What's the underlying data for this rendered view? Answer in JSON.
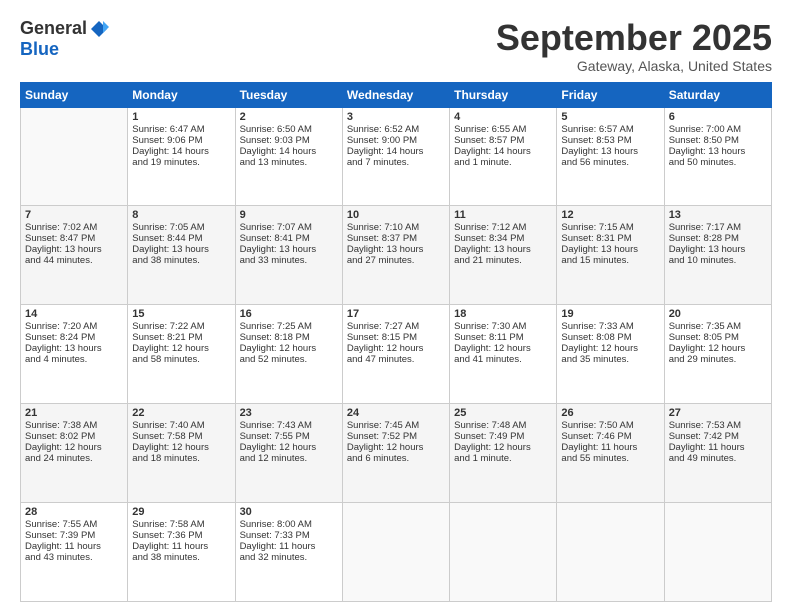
{
  "header": {
    "logo_general": "General",
    "logo_blue": "Blue",
    "month": "September 2025",
    "location": "Gateway, Alaska, United States"
  },
  "weekdays": [
    "Sunday",
    "Monday",
    "Tuesday",
    "Wednesday",
    "Thursday",
    "Friday",
    "Saturday"
  ],
  "weeks": [
    [
      {
        "day": "",
        "info": ""
      },
      {
        "day": "1",
        "info": "Sunrise: 6:47 AM\nSunset: 9:06 PM\nDaylight: 14 hours\nand 19 minutes."
      },
      {
        "day": "2",
        "info": "Sunrise: 6:50 AM\nSunset: 9:03 PM\nDaylight: 14 hours\nand 13 minutes."
      },
      {
        "day": "3",
        "info": "Sunrise: 6:52 AM\nSunset: 9:00 PM\nDaylight: 14 hours\nand 7 minutes."
      },
      {
        "day": "4",
        "info": "Sunrise: 6:55 AM\nSunset: 8:57 PM\nDaylight: 14 hours\nand 1 minute."
      },
      {
        "day": "5",
        "info": "Sunrise: 6:57 AM\nSunset: 8:53 PM\nDaylight: 13 hours\nand 56 minutes."
      },
      {
        "day": "6",
        "info": "Sunrise: 7:00 AM\nSunset: 8:50 PM\nDaylight: 13 hours\nand 50 minutes."
      }
    ],
    [
      {
        "day": "7",
        "info": "Sunrise: 7:02 AM\nSunset: 8:47 PM\nDaylight: 13 hours\nand 44 minutes."
      },
      {
        "day": "8",
        "info": "Sunrise: 7:05 AM\nSunset: 8:44 PM\nDaylight: 13 hours\nand 38 minutes."
      },
      {
        "day": "9",
        "info": "Sunrise: 7:07 AM\nSunset: 8:41 PM\nDaylight: 13 hours\nand 33 minutes."
      },
      {
        "day": "10",
        "info": "Sunrise: 7:10 AM\nSunset: 8:37 PM\nDaylight: 13 hours\nand 27 minutes."
      },
      {
        "day": "11",
        "info": "Sunrise: 7:12 AM\nSunset: 8:34 PM\nDaylight: 13 hours\nand 21 minutes."
      },
      {
        "day": "12",
        "info": "Sunrise: 7:15 AM\nSunset: 8:31 PM\nDaylight: 13 hours\nand 15 minutes."
      },
      {
        "day": "13",
        "info": "Sunrise: 7:17 AM\nSunset: 8:28 PM\nDaylight: 13 hours\nand 10 minutes."
      }
    ],
    [
      {
        "day": "14",
        "info": "Sunrise: 7:20 AM\nSunset: 8:24 PM\nDaylight: 13 hours\nand 4 minutes."
      },
      {
        "day": "15",
        "info": "Sunrise: 7:22 AM\nSunset: 8:21 PM\nDaylight: 12 hours\nand 58 minutes."
      },
      {
        "day": "16",
        "info": "Sunrise: 7:25 AM\nSunset: 8:18 PM\nDaylight: 12 hours\nand 52 minutes."
      },
      {
        "day": "17",
        "info": "Sunrise: 7:27 AM\nSunset: 8:15 PM\nDaylight: 12 hours\nand 47 minutes."
      },
      {
        "day": "18",
        "info": "Sunrise: 7:30 AM\nSunset: 8:11 PM\nDaylight: 12 hours\nand 41 minutes."
      },
      {
        "day": "19",
        "info": "Sunrise: 7:33 AM\nSunset: 8:08 PM\nDaylight: 12 hours\nand 35 minutes."
      },
      {
        "day": "20",
        "info": "Sunrise: 7:35 AM\nSunset: 8:05 PM\nDaylight: 12 hours\nand 29 minutes."
      }
    ],
    [
      {
        "day": "21",
        "info": "Sunrise: 7:38 AM\nSunset: 8:02 PM\nDaylight: 12 hours\nand 24 minutes."
      },
      {
        "day": "22",
        "info": "Sunrise: 7:40 AM\nSunset: 7:58 PM\nDaylight: 12 hours\nand 18 minutes."
      },
      {
        "day": "23",
        "info": "Sunrise: 7:43 AM\nSunset: 7:55 PM\nDaylight: 12 hours\nand 12 minutes."
      },
      {
        "day": "24",
        "info": "Sunrise: 7:45 AM\nSunset: 7:52 PM\nDaylight: 12 hours\nand 6 minutes."
      },
      {
        "day": "25",
        "info": "Sunrise: 7:48 AM\nSunset: 7:49 PM\nDaylight: 12 hours\nand 1 minute."
      },
      {
        "day": "26",
        "info": "Sunrise: 7:50 AM\nSunset: 7:46 PM\nDaylight: 11 hours\nand 55 minutes."
      },
      {
        "day": "27",
        "info": "Sunrise: 7:53 AM\nSunset: 7:42 PM\nDaylight: 11 hours\nand 49 minutes."
      }
    ],
    [
      {
        "day": "28",
        "info": "Sunrise: 7:55 AM\nSunset: 7:39 PM\nDaylight: 11 hours\nand 43 minutes."
      },
      {
        "day": "29",
        "info": "Sunrise: 7:58 AM\nSunset: 7:36 PM\nDaylight: 11 hours\nand 38 minutes."
      },
      {
        "day": "30",
        "info": "Sunrise: 8:00 AM\nSunset: 7:33 PM\nDaylight: 11 hours\nand 32 minutes."
      },
      {
        "day": "",
        "info": ""
      },
      {
        "day": "",
        "info": ""
      },
      {
        "day": "",
        "info": ""
      },
      {
        "day": "",
        "info": ""
      }
    ]
  ]
}
